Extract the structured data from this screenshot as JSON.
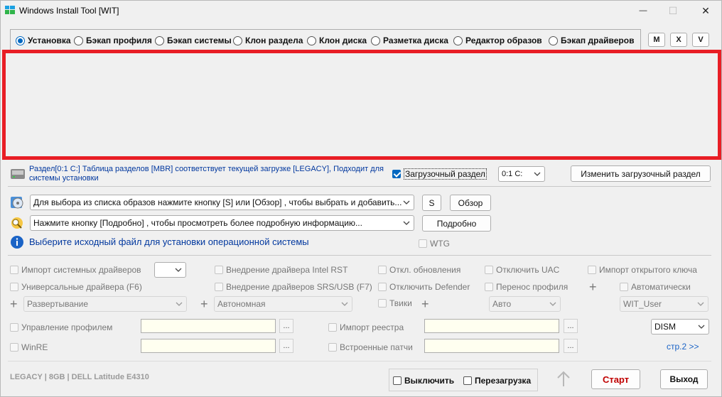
{
  "window": {
    "title": "Windows Install Tool [WIT]",
    "controls": {
      "minimize": "—",
      "maximize": "☐",
      "close": "✕"
    }
  },
  "modes": [
    {
      "label": "Установка",
      "selected": true
    },
    {
      "label": "Бэкап профиля",
      "selected": false
    },
    {
      "label": "Бэкап системы",
      "selected": false
    },
    {
      "label": "Клон раздела",
      "selected": false
    },
    {
      "label": "Клон диска",
      "selected": false
    },
    {
      "label": "Разметка диска",
      "selected": false
    },
    {
      "label": "Редактор образов",
      "selected": false
    },
    {
      "label": "Бэкап драйверов",
      "selected": false
    }
  ],
  "mode_buttons": [
    "M",
    "X",
    "V"
  ],
  "partition": {
    "info": "Раздел[0:1 C:] Таблица разделов [MBR] соответствует текущей загрузке [LEGACY], Подходит для системы установки",
    "boot_checkbox": "Загрузочный раздел",
    "boot_checked": true,
    "partition_select": "0:1 C:",
    "change_button": "Изменить загрузочный раздел"
  },
  "image": {
    "select_placeholder": "Для выбора из списка образов нажмите кнопку [S] или [Обзор] , чтобы выбрать и добавить...",
    "s_button": "S",
    "browse_button": "Обзор",
    "details_placeholder": "Нажмите кнопку [Подробно] , чтобы просмотреть более подробную информацию...",
    "details_button": "Подробно",
    "hint": "Выберите исходный файл для установки операционной системы",
    "wtg_label": "WTG"
  },
  "options": {
    "import_drivers": "Импорт системных драйверов",
    "intel_rst": "Внедрение драйвера Intel RST",
    "disable_updates": "Откл. обновления",
    "disable_uac": "Отключить UAC",
    "import_key": "Импорт открытого ключа",
    "universal_drivers": "Универсальные драйвера (F6)",
    "srs_usb": "Внедрение драйверов SRS/USB (F7)",
    "disable_defender": "Отключить Defender",
    "move_profile": "Перенос профиля",
    "automatic": "Автоматически",
    "deploy_select": "Развертывание",
    "offline_select": "Автономная",
    "tweaks": "Твики",
    "auto_select": "Авто",
    "user_select": "WIT_User",
    "profile_mgmt": "Управление профилем",
    "registry_import": "Импорт реестра",
    "dism_select": "DISM",
    "winre": "WinRE",
    "builtin_patches": "Встроенные патчи",
    "page_link": "стр.2 >>",
    "dots": "..."
  },
  "footer": {
    "system_info": "LEGACY | 8GB | DELL Latitude E4310",
    "shutdown": "Выключить",
    "reboot": "Перезагрузка",
    "start": "Старт",
    "exit": "Выход"
  },
  "colors": {
    "accent": "#0067c0",
    "highlight": "#e81e25",
    "start_text": "#c00000"
  }
}
